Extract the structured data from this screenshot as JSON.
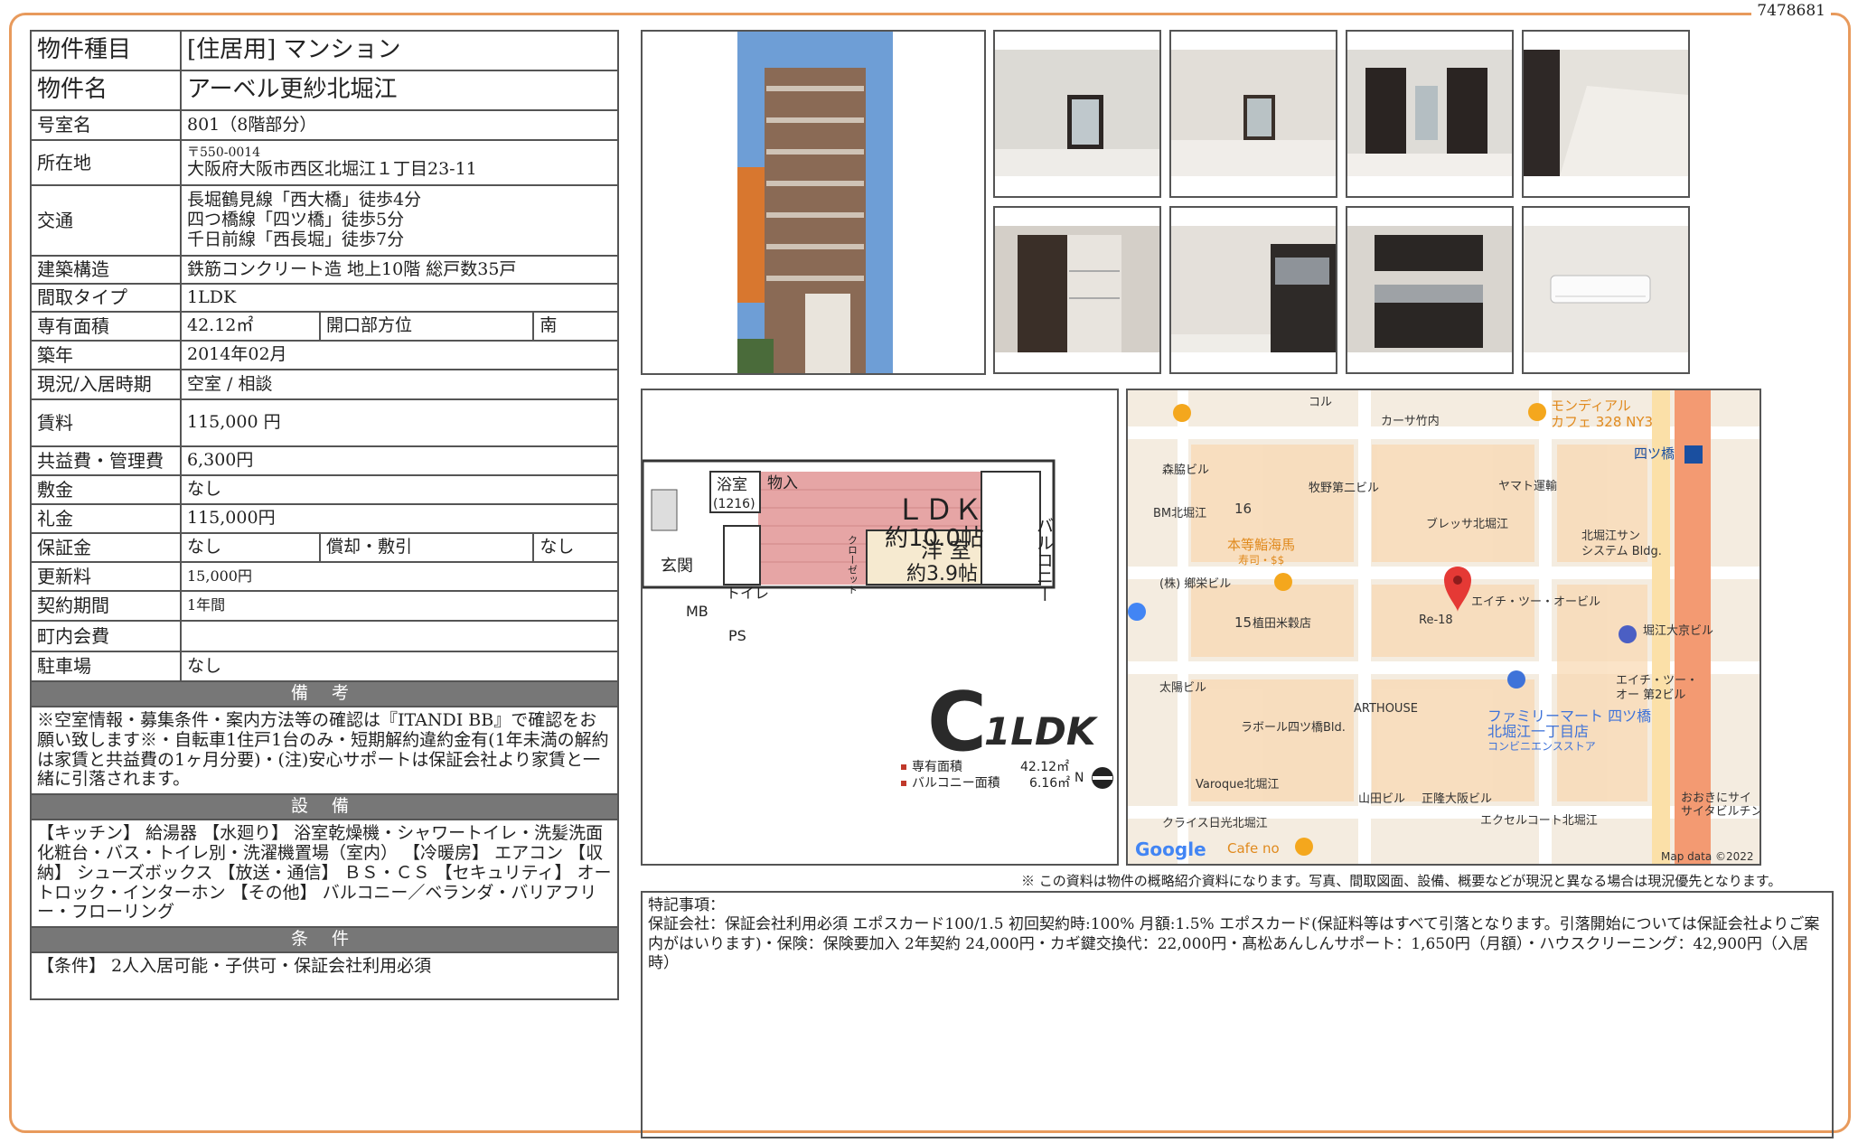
{
  "doc_id": "7478681",
  "property": {
    "type_label": "物件種目",
    "type_value": "[住居用]  マンション",
    "name_label": "物件名",
    "name_value": "アーベル更紗北堀江",
    "room_label": "号室名",
    "room_value": "801（8階部分）",
    "address_label": "所在地",
    "postal": "〒550-0014",
    "address_value": "大阪府大阪市西区北堀江１丁目23-11",
    "transport_label": "交通",
    "transport": [
      "長堀鶴見線「西大橋」徒歩4分",
      "四つ橋線「四ツ橋」徒歩5分",
      "千日前線「西長堀」徒歩7分"
    ],
    "structure_label": "建築構造",
    "structure_value": "鉄筋コンクリート造 地上10階 総戸数35戸",
    "layout_label": "間取タイプ",
    "layout_value": "1LDK",
    "area_label": "専有面積",
    "area_value": "42.12㎡",
    "direction_label": "開口部方位",
    "direction_value": "南",
    "built_label": "築年",
    "built_value": "2014年02月",
    "status_label": "現況/入居時期",
    "status_value": "空室 /  相談",
    "rent_label": "賃料",
    "rent_value": "115,000 円",
    "fee_label": "共益費・管理費",
    "fee_value": "6,300円",
    "deposit_label": "敷金",
    "deposit_value": "なし",
    "key_money_label": "礼金",
    "key_money_value": "115,000円",
    "guarantee_label": "保証金",
    "guarantee_value": "なし",
    "amortization_label": "償却・敷引",
    "amortization_value": "なし",
    "renewal_label": "更新料",
    "renewal_value": "15,000円",
    "contract_label": "契約期間",
    "contract_value": "1年間",
    "association_label": "町内会費",
    "association_value": "",
    "parking_label": "駐車場",
    "parking_value": "なし"
  },
  "sections": {
    "remarks_title": "備 考",
    "remarks_text": "※空室情報・募集条件・案内方法等の確認は『ITANDI BB』で確認をお願い致します※・自転車1住戸1台のみ・短期解約違約金有(1年未満の解約は家賃と共益費の1ヶ月分要)・(注)安心サポートは保証会社より家賃と一緒に引落されます。",
    "facilities_title": "設 備",
    "facilities_text": "【キッチン】 給湯器 【水廻り】 浴室乾燥機・シャワートイレ・洗髪洗面化粧台・バス・トイレ別・洗濯機置場（室内） 【冷暖房】 エアコン 【収納】 シューズボックス 【放送・通信】 ＢＳ・ＣＳ 【セキュリティ】 オートロック・インターホン 【その他】 バルコニー／ベランダ・バリアフリー・フローリング",
    "conditions_title": "条 件",
    "conditions_text": "【条件】 2人入居可能・子供可・保証会社利用必須"
  },
  "floorplan": {
    "ldk": "ＬＤＫ",
    "ldk_size": "約10.0帖",
    "western": "洋 室",
    "western_size": "約3.9帖",
    "balcony": "バルコニー",
    "bath": "浴室",
    "bath_size": "(1216)",
    "storage": "物入",
    "entrance": "玄関",
    "toilet": "トイレ",
    "closet": "クローゼット",
    "mb": "MB",
    "ps": "PS",
    "type_letter": "C",
    "type_name": "1LDK",
    "area_label": "専有面積",
    "area_value": "42.12㎡",
    "balcony_label": "バルコニー面積",
    "balcony_value": "6.16㎡",
    "north": "N"
  },
  "map": {
    "labels": [
      "コル",
      "カーサ竹内",
      "モンディアル",
      "カフェ 328 NY3",
      "四ツ橋",
      "森脇ビル",
      "牧野第二ビル",
      "ヤマト運輸",
      "BM北堀江",
      "16",
      "本等鮨海馬",
      "寿司・$$",
      "ブレッサ北堀江",
      "北堀江サン",
      "システム Bldg.",
      "(株) 鄉栄ビル",
      "エイチ・ツー・オービル",
      "15",
      "植田米穀店",
      "Re-18",
      "堀江大京ビル",
      "太陽ビル",
      "ARTHOUSE",
      "エイチ・ツー・",
      "オー 第2ビル",
      "ファミリーマート 四ツ橋",
      "北堀江一丁目店",
      "コンビニエンスストア",
      "ラボール四ツ橋Bld.",
      "Varoque北堀江",
      "山田ビル",
      "正隆大阪ビル",
      "おおきにサイ",
      "サイタビルチン",
      "クライス日光北堀江",
      "エクセルコート北堀江",
      "Cafe no"
    ],
    "google": "Google",
    "mapdata": "Map data ©2022"
  },
  "disclaimer": "※ この資料は物件の概略紹介資料になります。写真、間取図面、設備、概要などが現況と異なる場合は現況優先となります。",
  "special": {
    "title": "特記事項：",
    "text": "保証会社：保証会社利用必須 エポスカード100/1.5 初回契約時:100% 月額:1.5% エポスカード(保証料等はすべて引落となります。引落開始については保証会社よりご案内がはいります)・保険：保険要加入 2年契約 24,000円・カギ鍵交換代：22,000円・髙松あんしんサポート：1,650円（月額）・ハウスクリーニング：42,900円（入居時）"
  }
}
